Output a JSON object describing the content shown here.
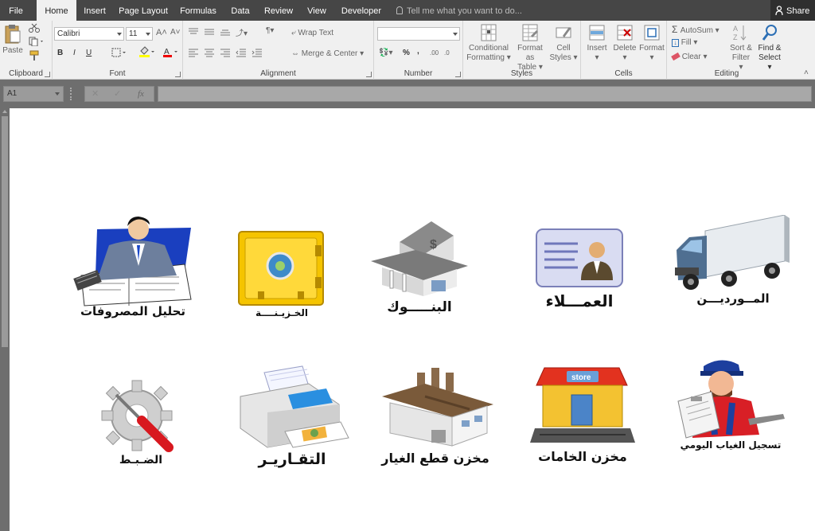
{
  "menu": {
    "tabs": [
      "File",
      "Home",
      "Insert",
      "Page Layout",
      "Formulas",
      "Data",
      "Review",
      "View",
      "Developer"
    ],
    "tell_me": "Tell me what you want to do...",
    "share": "Share"
  },
  "ribbon": {
    "clipboard": {
      "label": "Clipboard",
      "paste": "Paste"
    },
    "font": {
      "label": "Font",
      "name": "Calibri",
      "size": "11",
      "bold": "B",
      "italic": "I",
      "underline": "U"
    },
    "alignment": {
      "label": "Alignment",
      "wrap_text": "Wrap Text",
      "merge_center": "Merge & Center"
    },
    "number": {
      "label": "Number",
      "format": "",
      "percent": "%",
      "comma": ","
    },
    "styles": {
      "label": "Styles",
      "conditional_1": "Conditional",
      "conditional_2": "Formatting",
      "format_table_1": "Format as",
      "format_table_2": "Table",
      "cell_styles_1": "Cell",
      "cell_styles_2": "Styles"
    },
    "cells": {
      "label": "Cells",
      "insert": "Insert",
      "delete": "Delete",
      "format": "Format"
    },
    "editing": {
      "label": "Editing",
      "autosum": "AutoSum",
      "fill": "Fill",
      "clear": "Clear",
      "sort_1": "Sort &",
      "sort_2": "Filter",
      "find_1": "Find &",
      "find_2": "Select"
    }
  },
  "formula_bar": {
    "name_box": "A1",
    "fx": "fx",
    "value": ""
  },
  "tiles": {
    "expenses": "تحليل المصروفات",
    "treasury": "الخـزيـنــــة",
    "banks": "البنـــــوك",
    "customers": "العمـــلاء",
    "suppliers": "المــورديـــن",
    "settings": "الضـبـط",
    "reports": "التقـاريـر",
    "spare_parts": "مخزن قطع الغيار",
    "raw_materials": "مخزن الخامات",
    "attendance": "تسجيل الغياب اليومي"
  }
}
